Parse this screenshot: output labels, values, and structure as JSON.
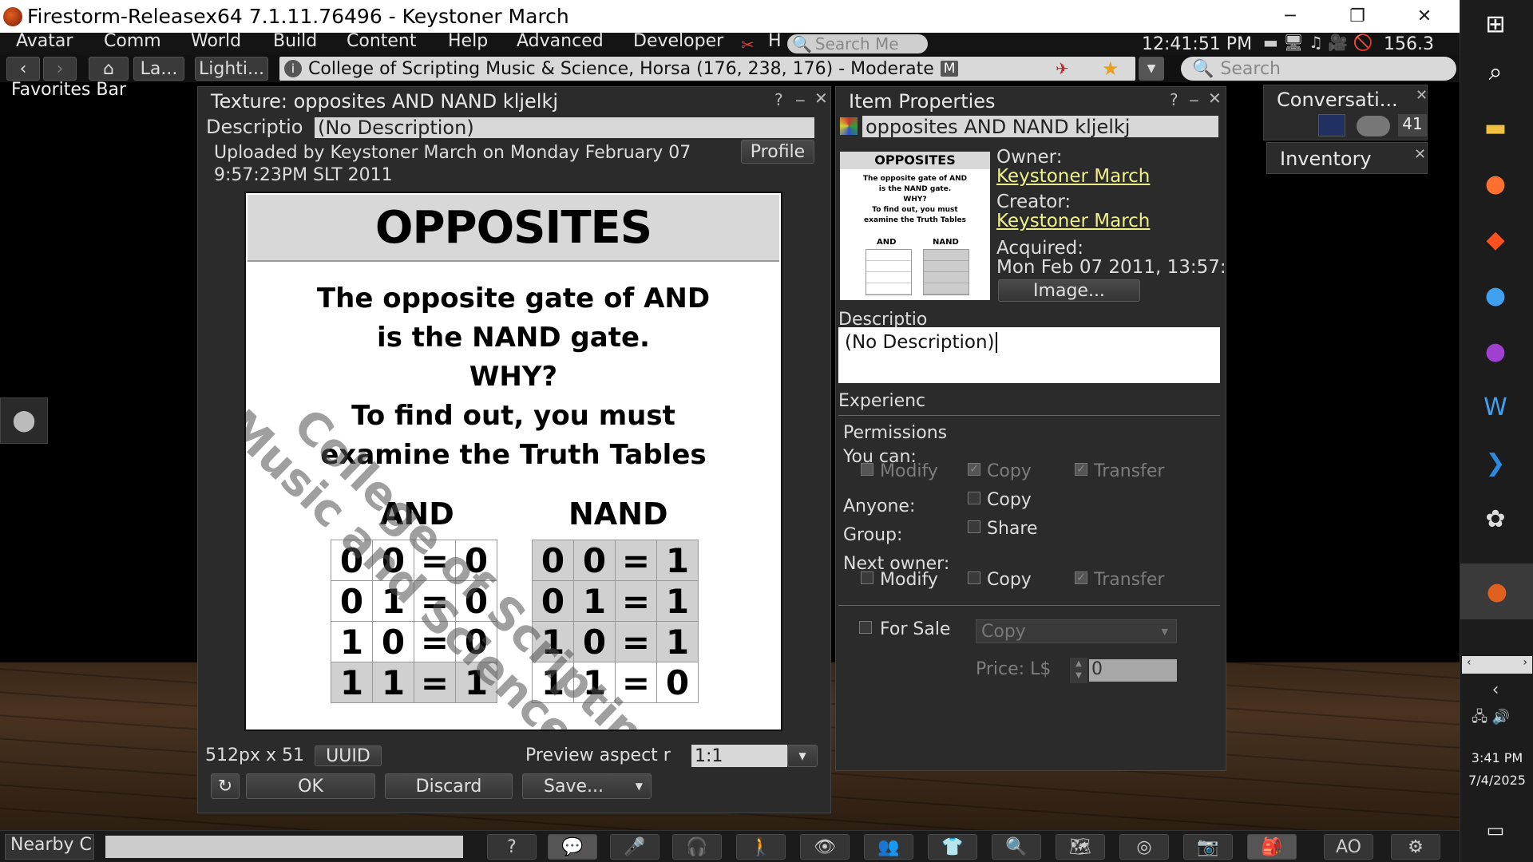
{
  "window": {
    "title": "Firestorm-Releasex64 7.1.11.76496 - Keystoner March",
    "controls": {
      "minimize": "─",
      "restore": "❐",
      "close": "✕"
    }
  },
  "menu": {
    "items": [
      "Avatar",
      "Comm",
      "World",
      "Build",
      "Content",
      "Help",
      "Advanced",
      "Developer"
    ],
    "h_label": "H",
    "search_placeholder": "Search Me",
    "clock": "12:41:51 PM",
    "fps": "156.3"
  },
  "nav": {
    "landmarks_label": "La...",
    "lighting_label": "Lighti...",
    "location": "College of Scripting Music & Science, Horsa (176, 238, 176) - Moderate",
    "maturity_badge": "M",
    "search_placeholder": "Search"
  },
  "favorites_bar": "Favorites Bar",
  "texture_window": {
    "title": "Texture: opposites AND NAND kljelkj",
    "help": "?",
    "description_label": "Descriptio",
    "description_value": "(No Description)",
    "uploaded_text": "Uploaded by Keystoner March on Monday February 07",
    "uploaded_time": "9:57:23PM SLT 2011",
    "profile_button": "Profile",
    "dimensions": "512px x 51",
    "uuid_button": "UUID",
    "preview_aspect_label": "Preview aspect r",
    "preview_aspect_value": "1:1",
    "ok_button": "OK",
    "discard_button": "Discard",
    "save_button": "Save..."
  },
  "texture_image": {
    "heading": "OPPOSITES",
    "line1": "The opposite gate of AND",
    "line2": "is the NAND gate.",
    "line3": "WHY?",
    "line4": "To find out, you must",
    "line5": "examine the Truth Tables",
    "and_label": "AND",
    "nand_label": "NAND",
    "and_rows": [
      [
        "0",
        "0",
        "=",
        "0"
      ],
      [
        "0",
        "1",
        "=",
        "0"
      ],
      [
        "1",
        "0",
        "=",
        "0"
      ],
      [
        "1",
        "1",
        "=",
        "1"
      ]
    ],
    "nand_rows": [
      [
        "0",
        "0",
        "=",
        "1"
      ],
      [
        "0",
        "1",
        "=",
        "1"
      ],
      [
        "1",
        "0",
        "=",
        "1"
      ],
      [
        "1",
        "1",
        "=",
        "0"
      ]
    ],
    "watermark_line1": "College of Scripting",
    "watermark_line2": "Music and Science"
  },
  "item_properties": {
    "title": "Item Properties",
    "help": "?",
    "name": "opposites AND NAND kljelkj",
    "owner_label": "Owner:",
    "owner": "Keystoner March",
    "creator_label": "Creator:",
    "creator": "Keystoner March",
    "acquired_label": "Acquired:",
    "acquired": "Mon Feb 07 2011, 13:57:",
    "image_button": "Image...",
    "description_label": "Descriptio",
    "description_value": "(No Description)",
    "experience_label": "Experienc",
    "permissions_label": "Permissions",
    "you_can_label": "You can:",
    "modify": "Modify",
    "copy": "Copy",
    "transfer": "Transfer",
    "anyone_label": "Anyone:",
    "group_label": "Group:",
    "share": "Share",
    "next_owner_label": "Next owner:",
    "for_sale_label": "For Sale",
    "sale_type": "Copy",
    "price_label": "Price: L$",
    "price_value": "0"
  },
  "conversations": {
    "title": "Conversati...",
    "count": "41"
  },
  "inventory": {
    "title": "Inventory"
  },
  "bottom": {
    "nearby_chat": "Nearby C",
    "ao_label": "AO"
  },
  "taskbar": {
    "time": "3:41 PM",
    "date": "7/4/2025"
  }
}
